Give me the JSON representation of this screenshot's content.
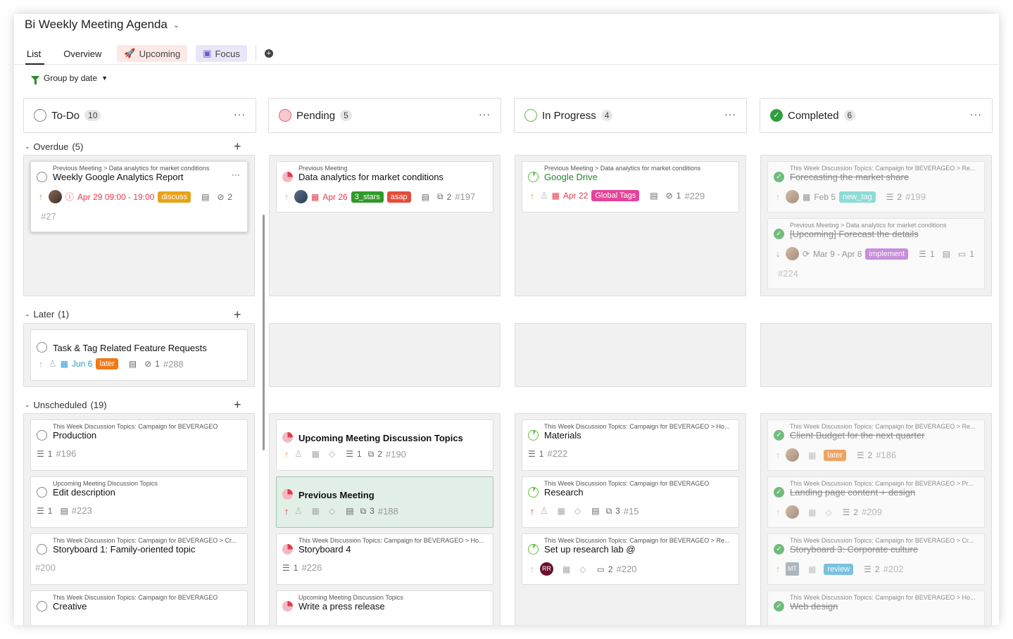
{
  "title": "Bi Weekly Meeting Agenda",
  "tabs": {
    "list": "List",
    "overview": "Overview",
    "upcoming": "Upcoming",
    "focus": "Focus"
  },
  "group_by": "Group by date",
  "columns": [
    {
      "name": "To-Do",
      "count": "10"
    },
    {
      "name": "Pending",
      "count": "5"
    },
    {
      "name": "In Progress",
      "count": "4"
    },
    {
      "name": "Completed",
      "count": "6"
    }
  ],
  "sections": {
    "overdue": "Overdue",
    "overdue_count": "(5)",
    "later": "Later",
    "later_count": "(1)",
    "unscheduled": "Unscheduled",
    "unscheduled_count": "(19)"
  },
  "cards": {
    "todo_overdue": {
      "crumb": "Previous Meeting > Data analytics for market conditions",
      "title": "Weekly Google Analytics Report",
      "date": "Apr 29  09:00 - 19:00",
      "tag": "discuss",
      "attach": "2",
      "num": "#27"
    },
    "pending_overdue": {
      "crumb": "Previous Meeting",
      "title": "Data analytics for market conditions",
      "date": "Apr 26",
      "tag1": "3_stars",
      "tag2": "asap",
      "subs": "2",
      "num": "#197"
    },
    "prog_overdue": {
      "crumb": "Previous Meeting > Data analytics for market conditions",
      "title": "Google Drive",
      "date": "Apr 22",
      "tag": "Global Tags",
      "attach": "1",
      "num": "#229"
    },
    "done_overdue1": {
      "crumb": "This Week Discussion Topics: Campaign for BEVERAGEO > Re...",
      "title": "Forecasting the market share",
      "date": "Feb 5",
      "tag": "new_tag",
      "subs": "2",
      "num": "#199"
    },
    "done_overdue2": {
      "crumb": "Previous Meeting > Data analytics for market conditions",
      "title": "[Upcoming] Forecast the details",
      "date": "Mar 9 - Apr 8",
      "tag": "implement",
      "subs": "1",
      "comments": "1",
      "num": "#224"
    },
    "todo_later": {
      "title": "Task & Tag Related Feature Requests",
      "date": "Jun 6",
      "tag": "later",
      "attach": "1",
      "num": "#288"
    },
    "todo_u1": {
      "crumb": "This Week Discussion Topics: Campaign for BEVERAGEO",
      "title": "Production",
      "subs": "1",
      "num": "#196"
    },
    "todo_u2": {
      "crumb": "Upcoming Meeting Discussion Topics",
      "title": "Edit description",
      "subs": "1",
      "num": "#223"
    },
    "todo_u3": {
      "crumb": "This Week Discussion Topics: Campaign for BEVERAGEO > Cr...",
      "title": "Storyboard 1: Family-oriented topic",
      "num": "#200"
    },
    "todo_u4": {
      "crumb": "This Week Discussion Topics: Campaign for BEVERAGEO",
      "title": "Creative"
    },
    "pend_u1": {
      "title": "Upcoming Meeting Discussion Topics",
      "subs": "1",
      "sub2": "2",
      "num": "#190"
    },
    "pend_u2": {
      "title": "Previous Meeting",
      "sub2": "3",
      "num": "#188"
    },
    "pend_u3": {
      "crumb": "This Week Discussion Topics: Campaign for BEVERAGEO > Ho...",
      "title": "Storyboard 4",
      "subs": "1",
      "num": "#226"
    },
    "pend_u4": {
      "crumb": "Upcoming Meeting Discussion Topics",
      "title": "Write a press release"
    },
    "prog_u1": {
      "crumb": "This Week Discussion Topics: Campaign for BEVERAGEO > Ho...",
      "title": "Materials",
      "subs": "1",
      "num": "#222"
    },
    "prog_u2": {
      "crumb": "This Week Discussion Topics: Campaign for BEVERAGEO",
      "title": "Research",
      "sub2": "3",
      "num": "#15"
    },
    "prog_u3": {
      "crumb": "This Week Discussion Topics: Campaign for BEVERAGEO > Re...",
      "title": "Set up research lab @",
      "avatar": "RR",
      "comments": "2",
      "num": "#220"
    },
    "done_u1": {
      "crumb": "This Week Discussion Topics: Campaign for BEVERAGEO > Re...",
      "title": "Client Budget for the next quarter",
      "tag": "later",
      "subs": "2",
      "num": "#186"
    },
    "done_u2": {
      "crumb": "This Week Discussion Topics: Campaign for BEVERAGEO > Pr...",
      "title": "Landing page content + design",
      "subs": "2",
      "num": "#209"
    },
    "done_u3": {
      "crumb": "This Week Discussion Topics: Campaign for BEVERAGEO > Cr...",
      "title": "Storyboard 3: Corporate culture",
      "avatar": "MT",
      "tag": "review",
      "subs": "2",
      "num": "#202"
    },
    "done_u4": {
      "crumb": "This Week Discussion Topics: Campaign for BEVERAGEO > Ho...",
      "title": "Web design"
    }
  }
}
